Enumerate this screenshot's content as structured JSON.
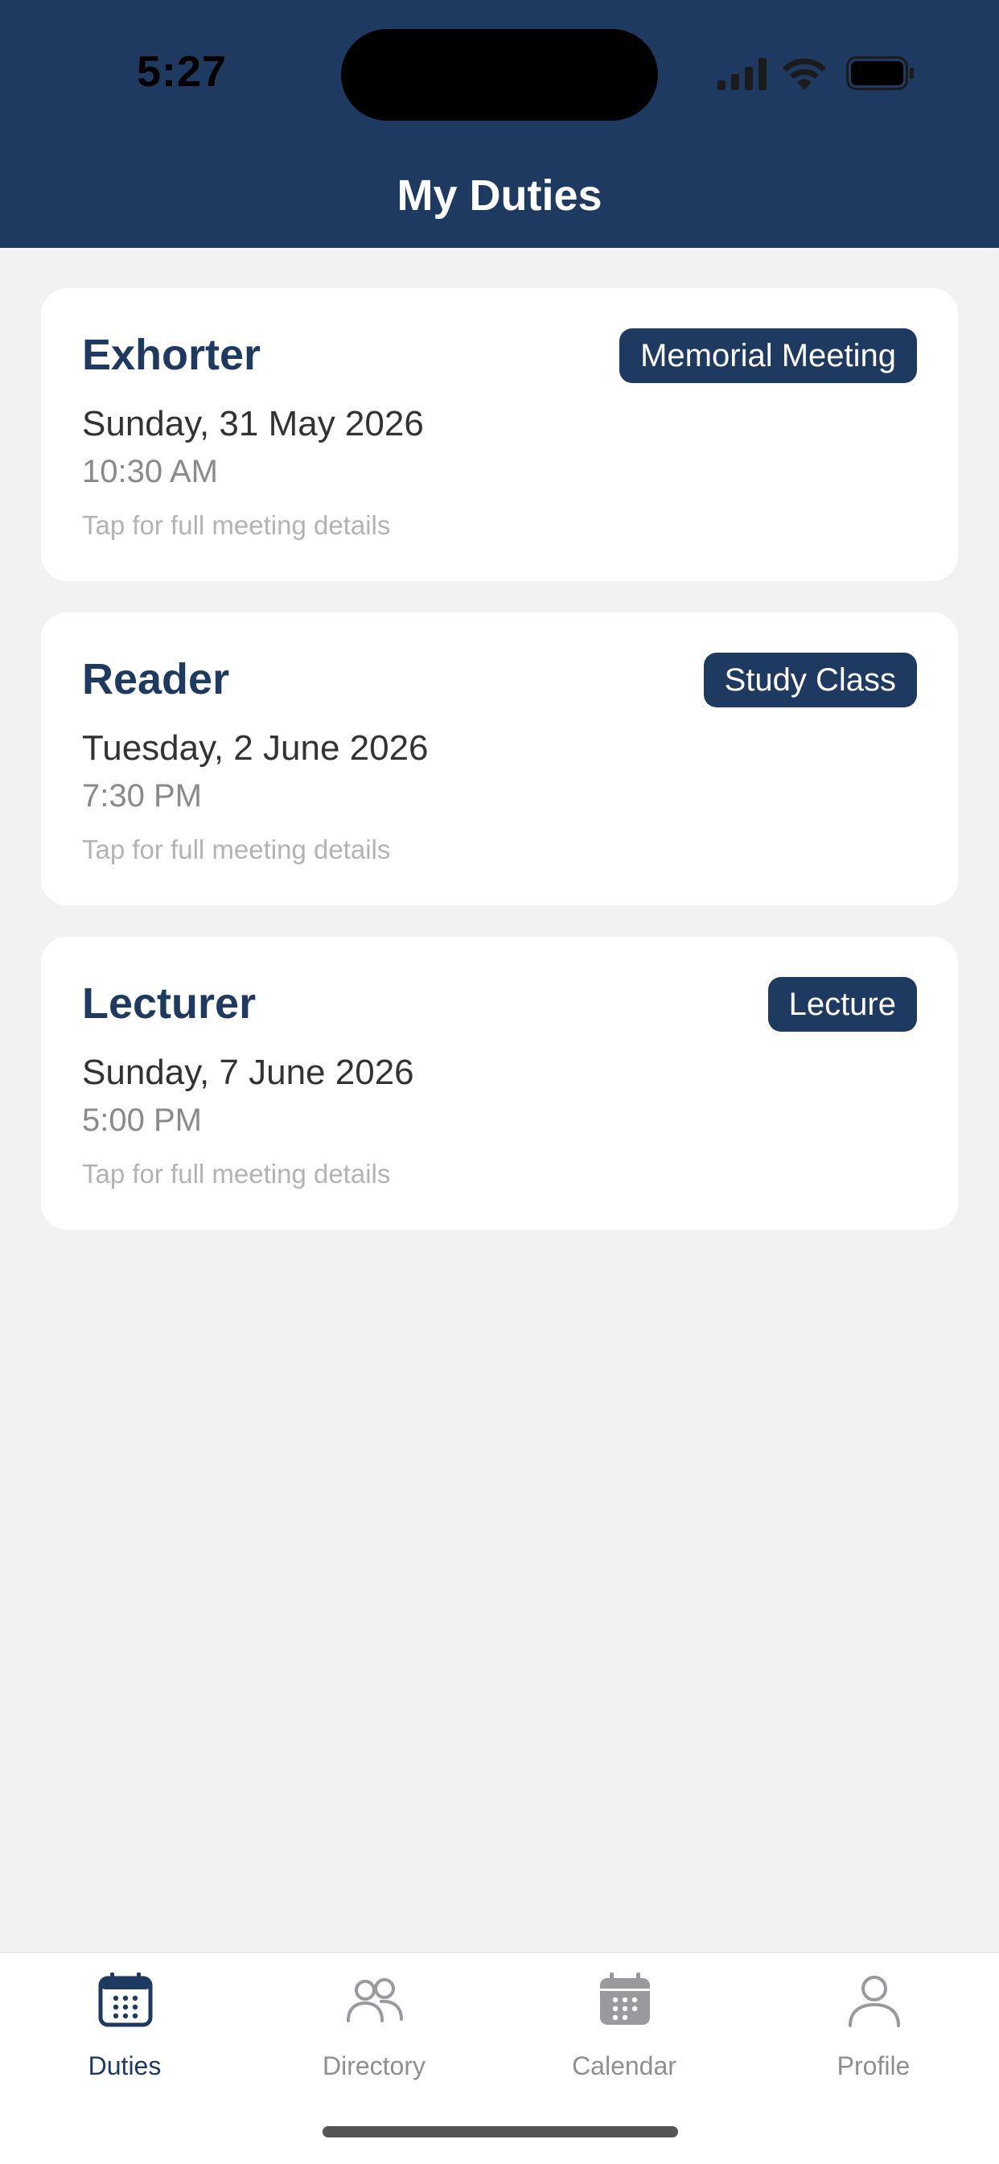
{
  "status_bar": {
    "time": "5:27"
  },
  "header": {
    "title": "My Duties"
  },
  "duties": [
    {
      "role": "Exhorter",
      "badge": "Memorial Meeting",
      "date": "Sunday, 31 May 2026",
      "time": "10:30 AM",
      "hint": "Tap for full meeting details"
    },
    {
      "role": "Reader",
      "badge": "Study Class",
      "date": "Tuesday, 2 June 2026",
      "time": "7:30 PM",
      "hint": "Tap for full meeting details"
    },
    {
      "role": "Lecturer",
      "badge": "Lecture",
      "date": "Sunday, 7 June 2026",
      "time": "5:00 PM",
      "hint": "Tap for full meeting details"
    }
  ],
  "tabbar": {
    "tabs": [
      {
        "label": "Duties",
        "icon": "calendar-icon",
        "active": true
      },
      {
        "label": "Directory",
        "icon": "people-icon",
        "active": false
      },
      {
        "label": "Calendar",
        "icon": "calendar-filled-icon",
        "active": false
      },
      {
        "label": "Profile",
        "icon": "person-icon",
        "active": false
      }
    ]
  },
  "colors": {
    "primary": "#1f3a60",
    "background": "#f2f2f2",
    "card": "#ffffff",
    "inactive_tab": "#8e8e93"
  }
}
